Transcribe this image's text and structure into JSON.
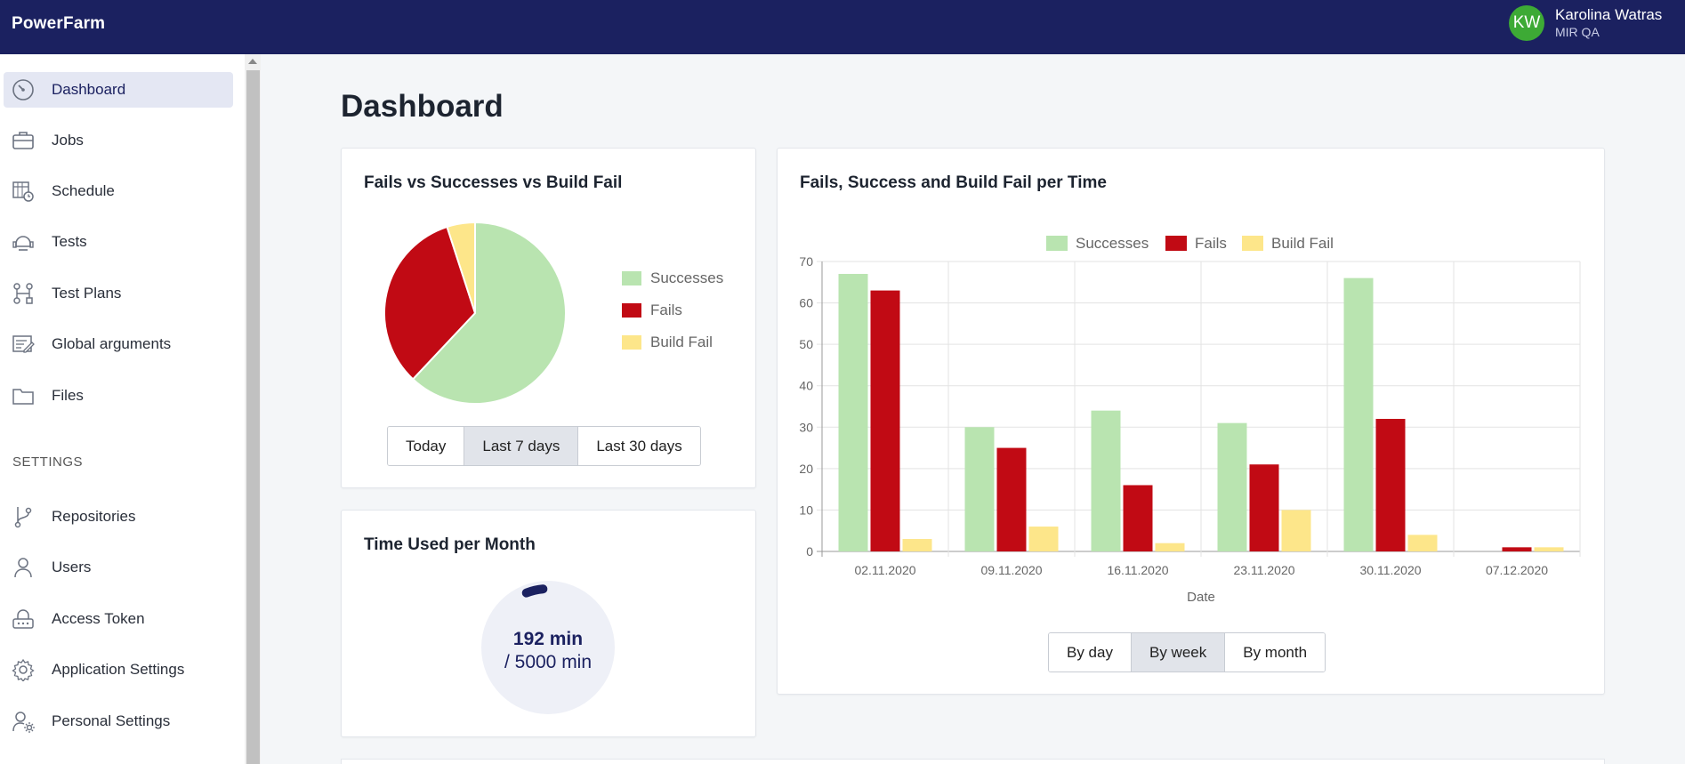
{
  "app": {
    "name": "PowerFarm"
  },
  "user": {
    "initials": "KW",
    "name": "Karolina Watras",
    "role": "MIR QA",
    "avatar_color": "#3daa35"
  },
  "sidebar": {
    "items": [
      {
        "label": "Dashboard",
        "icon": "dashboard-gauge-icon",
        "active": true
      },
      {
        "label": "Jobs",
        "icon": "briefcase-icon"
      },
      {
        "label": "Schedule",
        "icon": "calendar-clock-icon"
      },
      {
        "label": "Tests",
        "icon": "robot-icon"
      },
      {
        "label": "Test Plans",
        "icon": "test-plan-flow-icon"
      },
      {
        "label": "Global arguments",
        "icon": "list-pen-icon"
      },
      {
        "label": "Files",
        "icon": "folder-icon"
      }
    ],
    "settings_header": "SETTINGS",
    "settings_items": [
      {
        "label": "Repositories",
        "icon": "git-branch-icon"
      },
      {
        "label": "Users",
        "icon": "user-icon"
      },
      {
        "label": "Access Token",
        "icon": "token-router-icon"
      },
      {
        "label": "Application Settings",
        "icon": "gear-icon"
      },
      {
        "label": "Personal Settings",
        "icon": "user-gear-icon"
      }
    ]
  },
  "page": {
    "title": "Dashboard"
  },
  "colors": {
    "successes": "#b9e4b0",
    "fails": "#c10a14",
    "build_fail": "#fde68a",
    "brand": "#1b2160"
  },
  "pie_card": {
    "title": "Fails vs Successes vs Build Fail",
    "legend": [
      "Successes",
      "Fails",
      "Build Fail"
    ],
    "range_buttons": [
      "Today",
      "Last 7 days",
      "Last 30 days"
    ],
    "selected_range": "Last 7 days"
  },
  "time_card": {
    "title": "Time Used per Month",
    "used": "192 min",
    "total": "/ 5000 min",
    "used_fraction": 0.0384
  },
  "bar_card": {
    "title": "Fails, Success and Build Fail per Time",
    "range_buttons": [
      "By day",
      "By week",
      "By month"
    ],
    "selected_range": "By week"
  },
  "chart_data": [
    {
      "type": "pie",
      "title": "Fails vs Successes vs Build Fail",
      "labels": [
        "Successes",
        "Fails",
        "Build Fail"
      ],
      "values": [
        62,
        33,
        5
      ]
    },
    {
      "type": "bar",
      "title": "Fails, Success and Build Fail per Time",
      "xlabel": "Date",
      "ylabel": "",
      "categories": [
        "02.11.2020",
        "09.11.2020",
        "16.11.2020",
        "23.11.2020",
        "30.11.2020",
        "07.12.2020"
      ],
      "series": [
        {
          "name": "Successes",
          "values": [
            67,
            30,
            34,
            31,
            66,
            0
          ]
        },
        {
          "name": "Fails",
          "values": [
            63,
            25,
            16,
            21,
            32,
            1
          ]
        },
        {
          "name": "Build Fail",
          "values": [
            3,
            6,
            2,
            10,
            4,
            1
          ]
        }
      ],
      "ylim": [
        0,
        70
      ],
      "yticks": [
        0,
        10,
        20,
        30,
        40,
        50,
        60,
        70
      ],
      "grid": true,
      "legend_position": "top"
    }
  ]
}
